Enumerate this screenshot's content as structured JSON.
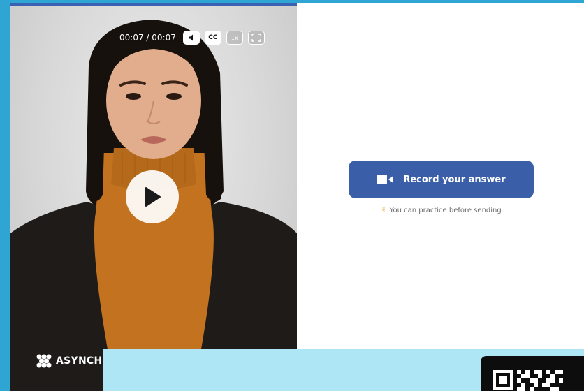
{
  "video": {
    "time_display": "00:07 / 00:07",
    "cc_label": "CC",
    "speed_label": "1x",
    "brand_name": "ASYNCHE"
  },
  "record": {
    "button_label": "Record your answer",
    "hint_emoji": "✌",
    "hint_text": "You can practice before sending"
  },
  "colors": {
    "page_background": "#2ea5d3",
    "record_button": "#3a5fa8",
    "banner": "#aee6f5"
  }
}
